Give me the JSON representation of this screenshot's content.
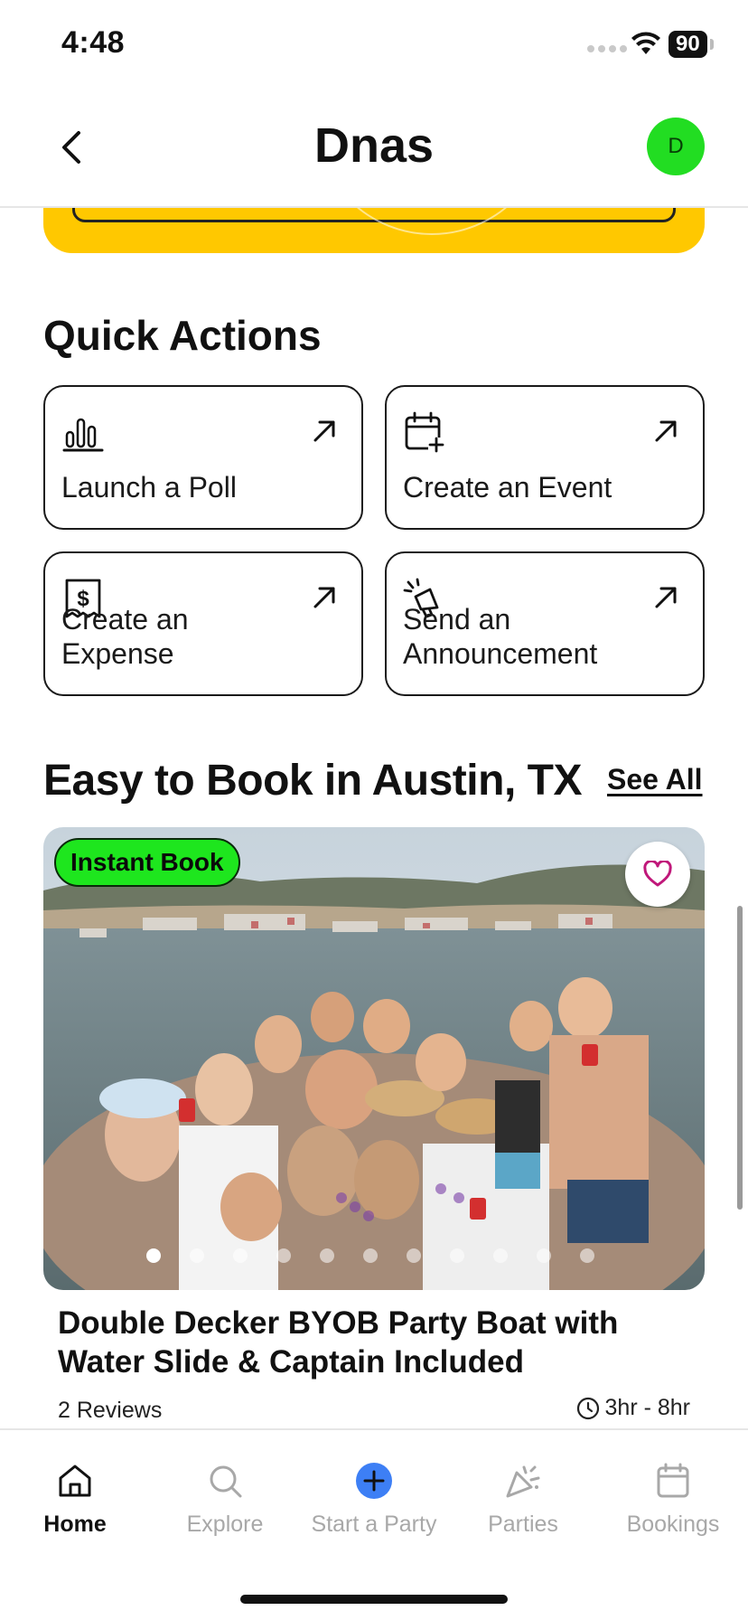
{
  "status_bar": {
    "time": "4:48",
    "battery": "90"
  },
  "header": {
    "title": "Dnas",
    "avatar_initial": "D"
  },
  "quick_actions": {
    "title": "Quick Actions",
    "items": [
      {
        "label": "Launch a Poll",
        "icon": "bar-chart-icon"
      },
      {
        "label": "Create an Event",
        "icon": "calendar-plus-icon"
      },
      {
        "label": "Create an Expense",
        "icon": "receipt-dollar-icon"
      },
      {
        "label": "Send an Announcement",
        "icon": "megaphone-icon"
      }
    ]
  },
  "easy_to_book": {
    "title": "Easy to Book in Austin, TX",
    "see_all": "See All",
    "listing": {
      "badge": "Instant Book",
      "title": "Double Decker BYOB Party Boat with Water Slide & Captain Included",
      "reviews": "2 Reviews",
      "duration": "3hr - 8hr",
      "image_count": 11,
      "active_image": 1
    }
  },
  "tabs": [
    {
      "label": "Home",
      "icon": "home-icon",
      "active": true
    },
    {
      "label": "Explore",
      "icon": "search-icon",
      "active": false
    },
    {
      "label": "Start a Party",
      "icon": "plus-circle-icon",
      "active": false
    },
    {
      "label": "Parties",
      "icon": "party-popper-icon",
      "active": false
    },
    {
      "label": "Bookings",
      "icon": "calendar-icon",
      "active": false
    }
  ],
  "colors": {
    "accent_yellow": "#ffc800",
    "instant_green": "#1ee61e",
    "avatar_green": "#22dd22",
    "tab_blue": "#3d7ff5",
    "heart_pink": "#c0187a"
  }
}
